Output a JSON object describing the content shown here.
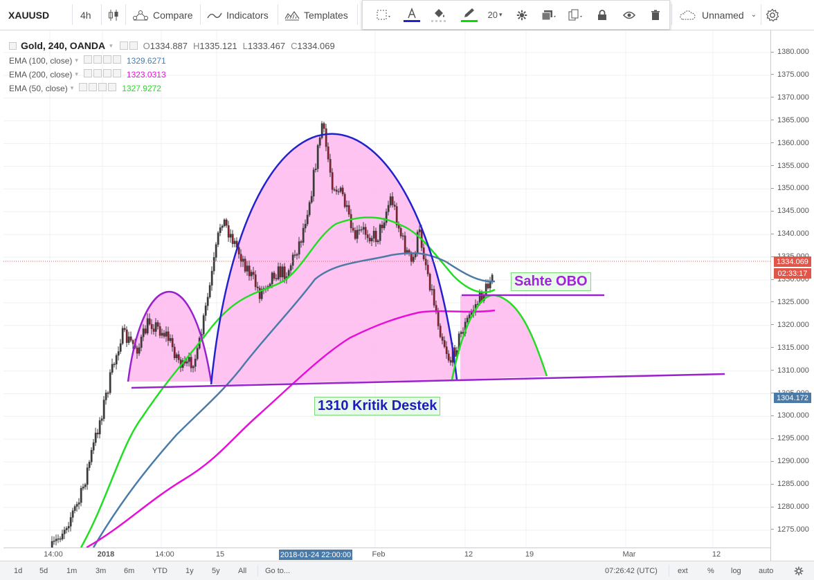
{
  "toolbar": {
    "symbol": "XAUUSD",
    "interval": "4h",
    "compare": "Compare",
    "indicators": "Indicators",
    "templates": "Templates",
    "layout_name": "Unnamed"
  },
  "drawing_toolbar": {
    "font_size": "20",
    "line_color": "#2222cc",
    "fill_color": "#ffffff",
    "pen_color": "#00e000"
  },
  "legend": {
    "main": {
      "title": "Gold, 240, OANDA",
      "o_label": "O",
      "o_value": "1334.887",
      "h_label": "H",
      "h_value": "1335.121",
      "l_label": "L",
      "l_value": "1333.467",
      "c_label": "C",
      "c_value": "1334.069"
    },
    "studies": [
      {
        "name": "EMA (100, close)",
        "value": "1329.6271",
        "color": "#4a7ba8"
      },
      {
        "name": "EMA (200, close)",
        "value": "1323.0313",
        "color": "#e60fd8"
      },
      {
        "name": "EMA (50, close)",
        "value": "1327.9272",
        "color": "#22dd22"
      }
    ]
  },
  "price_axis": {
    "ticks": [
      "1380.000",
      "1375.000",
      "1370.000",
      "1365.000",
      "1360.000",
      "1355.000",
      "1350.000",
      "1345.000",
      "1340.000",
      "1335.000",
      "1330.000",
      "1325.000",
      "1320.000",
      "1315.000",
      "1310.000",
      "1305.000",
      "1300.000",
      "1295.000",
      "1290.000",
      "1285.000",
      "1280.000",
      "1275.000"
    ],
    "last_price": "1334.069",
    "countdown": "02:33:17",
    "crosshair_price": "1304.172"
  },
  "time_axis": {
    "ticks": [
      "14:00",
      "2018",
      "14:00",
      "15",
      "Feb",
      "12",
      "19",
      "Mar",
      "12"
    ],
    "crosshair_time": "2018-01-24 22:00:00"
  },
  "annotations": {
    "fake_obo": "Sahte OBO",
    "support": "1310 Kritik Destek"
  },
  "bottom": {
    "ranges": [
      "1d",
      "5d",
      "1m",
      "3m",
      "6m",
      "YTD",
      "1y",
      "5y",
      "All"
    ],
    "goto": "Go to...",
    "clock": "07:26:42 (UTC)",
    "toggles": [
      "ext",
      "%",
      "log",
      "auto"
    ]
  },
  "colors": {
    "ema50": "#22dd22",
    "ema100": "#4a7ba8",
    "ema200": "#e60fd8",
    "shape_fill": "#ffb8ef",
    "arc_small": "#9922cc",
    "arc_big": "#2222cc",
    "trendline": "#9922cc",
    "candle_up": "#3a3a3a",
    "candle_down": "#8b1c2c",
    "last_price_bg": "#e0574a",
    "crosshair_bg": "#4a7ba8"
  }
}
